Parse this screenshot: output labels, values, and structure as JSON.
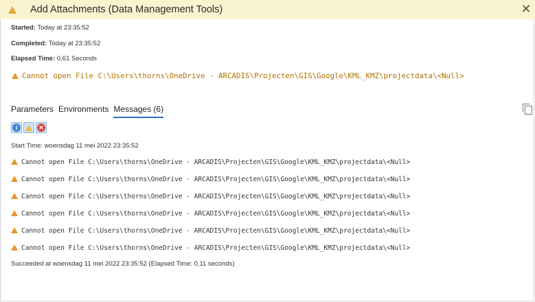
{
  "header": {
    "title": "Add Attachments (Data Management Tools)",
    "close_label": "✕"
  },
  "info": {
    "started_label": "Started:",
    "started_value": " Today at 23:35:52",
    "completed_label": "Completed:",
    "completed_value": " Today at 23:35:52",
    "elapsed_label": "Elapsed Time:",
    "elapsed_value": " 0,61 Seconds",
    "warning": "Cannot open File C:\\Users\\thorns\\OneDrive - ARCADIS\\Projecten\\GIS\\Google\\KML_KMZ\\projectdata\\<Null>"
  },
  "tabs": [
    {
      "label": "Parameters"
    },
    {
      "label": "Environments"
    },
    {
      "label": "Messages (6)"
    }
  ],
  "filters": {
    "info_glyph": "i",
    "error_glyph": "✕"
  },
  "messages": {
    "start": "Start Time: woensdag 11 mei 2022 23:35:52",
    "warnings": [
      "Cannot open File C:\\Users\\thorns\\OneDrive - ARCADIS\\Projecten\\GIS\\Google\\KML_KMZ\\projectdata\\<Null>",
      "Cannot open File C:\\Users\\thorns\\OneDrive - ARCADIS\\Projecten\\GIS\\Google\\KML_KMZ\\projectdata\\<Null>",
      "Cannot open File C:\\Users\\thorns\\OneDrive - ARCADIS\\Projecten\\GIS\\Google\\KML_KMZ\\projectdata\\<Null>",
      "Cannot open File C:\\Users\\thorns\\OneDrive - ARCADIS\\Projecten\\GIS\\Google\\KML_KMZ\\projectdata\\<Null>",
      "Cannot open File C:\\Users\\thorns\\OneDrive - ARCADIS\\Projecten\\GIS\\Google\\KML_KMZ\\projectdata\\<Null>",
      "Cannot open File C:\\Users\\thorns\\OneDrive - ARCADIS\\Projecten\\GIS\\Google\\KML_KMZ\\projectdata\\<Null>"
    ],
    "end": "Succeeded at woensdag 11 mei 2022 23:35:52 (Elapsed Time: 0,11 seconds)"
  },
  "colors": {
    "header_bg": "#faf3cf",
    "warning_icon": "#e39a2d",
    "warning_text": "#b07200",
    "tab_underline": "#2b6fc2"
  }
}
